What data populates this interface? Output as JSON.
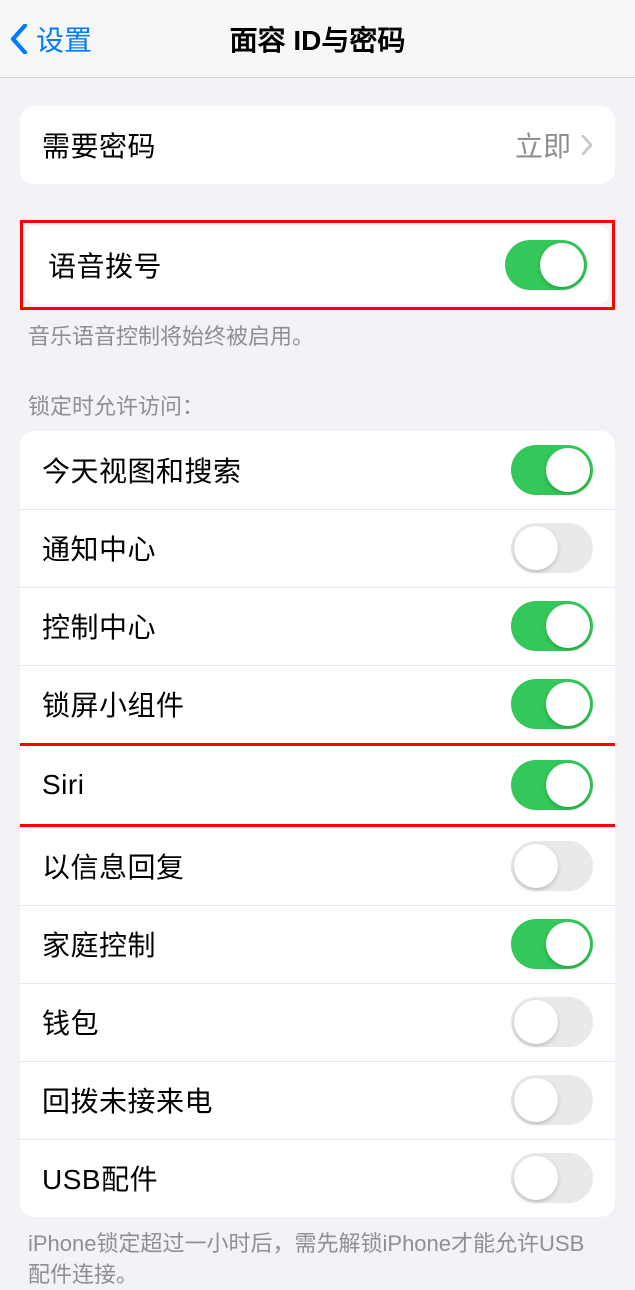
{
  "nav": {
    "back_label": "设置",
    "title": "面容 ID与密码"
  },
  "require_passcode": {
    "label": "需要密码",
    "value": "立即"
  },
  "voice_dial": {
    "label": "语音拨号",
    "on": true,
    "footer": "音乐语音控制将始终被启用。"
  },
  "lock_access": {
    "header": "锁定时允许访问：",
    "items": [
      {
        "label": "今天视图和搜索",
        "on": true,
        "highlight": false
      },
      {
        "label": "通知中心",
        "on": false,
        "highlight": false
      },
      {
        "label": "控制中心",
        "on": true,
        "highlight": false
      },
      {
        "label": "锁屏小组件",
        "on": true,
        "highlight": false
      },
      {
        "label": "Siri",
        "on": true,
        "highlight": true
      },
      {
        "label": "以信息回复",
        "on": false,
        "highlight": false
      },
      {
        "label": "家庭控制",
        "on": true,
        "highlight": false
      },
      {
        "label": "钱包",
        "on": false,
        "highlight": false
      },
      {
        "label": "回拨未接来电",
        "on": false,
        "highlight": false
      },
      {
        "label": "USB配件",
        "on": false,
        "highlight": false
      }
    ],
    "footer": "iPhone锁定超过一小时后，需先解锁iPhone才能允许USB 配件连接。"
  }
}
